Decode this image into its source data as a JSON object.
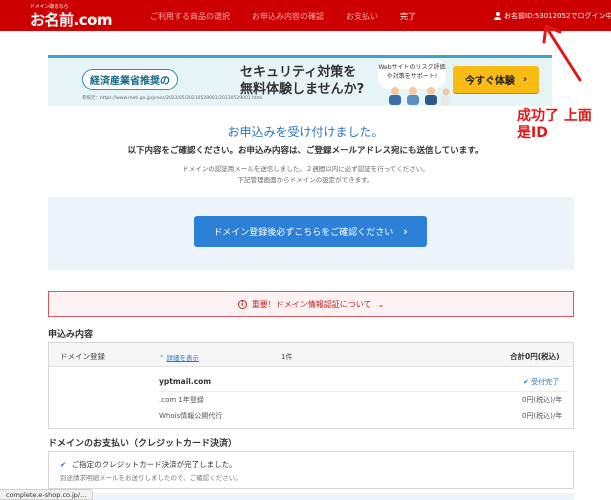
{
  "header": {
    "logo_small": "ドメイン取るなら",
    "logo_main": "お名前.com",
    "logo_sub": "by GMO",
    "steps": [
      {
        "label": "ご利用する商品の選択",
        "current": false
      },
      {
        "label": "お申込み内容の確認",
        "current": false
      },
      {
        "label": "お支払い",
        "current": false
      },
      {
        "label": "完了",
        "current": true
      }
    ],
    "login_text": "お名前ID:53012052でログイン中"
  },
  "banner": {
    "pill": "経済産業省推奨の",
    "line1": "セキュリティ対策を",
    "line2": "無料体験しませんか?",
    "bubble": "Webサイトのリスク評価や対策をサポート!",
    "button": "今すぐ体験",
    "url": "参照元：https://www.meti.go.jp/press/2023/05/20230529001/20230529001.html"
  },
  "annotation": {
    "text_line1": "成功了 上面",
    "text_line2": "是ID",
    "color": "#e01818"
  },
  "main": {
    "title": "お申込みを受け付けました。",
    "subtitle": "以下内容をご確認ください。お申込み内容は、ご登録メールアドレス宛にも送信しています。",
    "note1": "ドメインの認証用メールを送信しました。２週間以内に必ず認証を行ってください。",
    "note2": "下記管理画面からドメインの設定ができます。",
    "confirm_button": "ドメイン登録後必ずこちらをご確認ください",
    "notice": "重要！ドメイン情報認証について"
  },
  "order": {
    "section_title": "申込み内容",
    "label": "ドメイン登録",
    "details_link": "詳細を表示",
    "count": "1件",
    "total": "合計0円(税込)",
    "domain": "yptmail.com",
    "status": "受付完了",
    "items": [
      {
        "label": ".com 1年登録",
        "price": "0円(税込)/年"
      },
      {
        "label": "Whois情報公開代行",
        "price": "0円(税込)/年"
      }
    ]
  },
  "payment": {
    "section_title": "ドメインのお支払い（クレジットカード決済）",
    "line1": "ご指定のクレジットカード決済が完了しました。",
    "line2": "別途請求明細メールをお送りしましたので、ご確認ください。"
  },
  "status_bar": {
    "url": "complete.e-shop.co.jp/..."
  },
  "colors": {
    "header_red": "#cc0000",
    "accent_blue": "#2c80d8",
    "banner_button": "#f9bb14",
    "notice_red": "#c41f1f"
  }
}
